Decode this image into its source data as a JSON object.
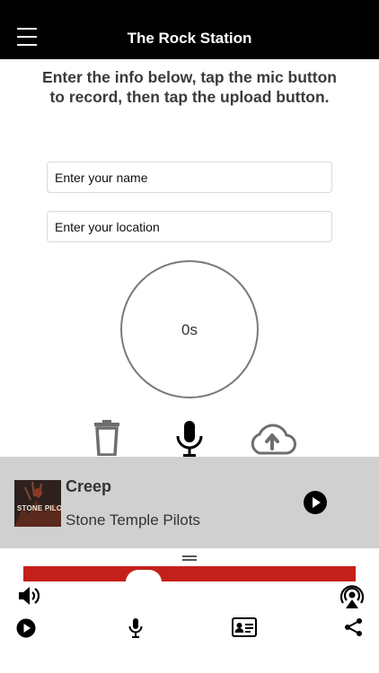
{
  "header": {
    "title": "The Rock Station"
  },
  "instructions": "Enter the info below, tap the mic button to record, then tap the upload button.",
  "form": {
    "name_placeholder": "Enter your name",
    "location_placeholder": "Enter your location"
  },
  "recorder": {
    "timer": "0s",
    "actions": [
      "trash-icon",
      "microphone-icon",
      "cloud-upload-icon"
    ]
  },
  "now_playing": {
    "title": "Creep",
    "artist": "Stone Temple Pilots",
    "album_art_text": "STONE PILOTS"
  },
  "bottom_controls": {
    "top_row": [
      "volume-icon",
      "airplay-icon"
    ],
    "bottom_row": [
      "play-icon",
      "microphone-icon",
      "contact-card-icon",
      "share-icon"
    ]
  },
  "colors": {
    "header_bg": "#000000",
    "player_bg": "#d0d0d0",
    "banner_red": "#c4201a"
  }
}
